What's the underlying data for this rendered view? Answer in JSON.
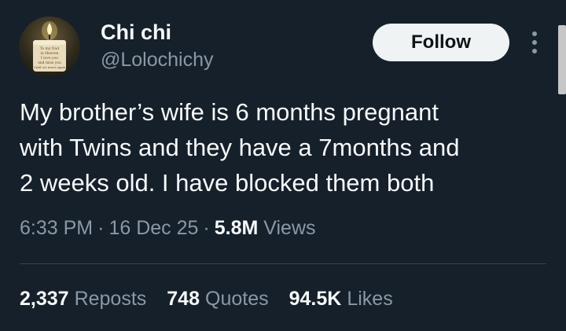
{
  "author": {
    "display_name": "Chi chi",
    "handle": "@Lolochichy",
    "avatar_icon": "candle-memorial-icon",
    "avatar_text": [
      "To my Dad",
      "in Heaven",
      "I love you",
      "and miss you",
      "Until we meet again"
    ]
  },
  "actions": {
    "follow_label": "Follow",
    "more_icon": "more-options-icon"
  },
  "tweet": {
    "lines": [
      "My brother’s wife is 6 months pregnant",
      "with Twins and they have a 7months and",
      "2 weeks old. I have blocked them both"
    ]
  },
  "meta": {
    "time": "6:33 PM",
    "separator": "·",
    "date": "16 Dec 25",
    "views_count": "5.8M",
    "views_label": "Views"
  },
  "stats": {
    "reposts_count": "2,337",
    "reposts_label": "Reposts",
    "quotes_count": "748",
    "quotes_label": "Quotes",
    "likes_count": "94.5K",
    "likes_label": "Likes"
  },
  "colors": {
    "background": "#15202b",
    "primary_text": "#f7f9f9",
    "secondary_text": "#8b98a5",
    "follow_button_bg": "#eff3f4",
    "divider": "#38444d"
  }
}
